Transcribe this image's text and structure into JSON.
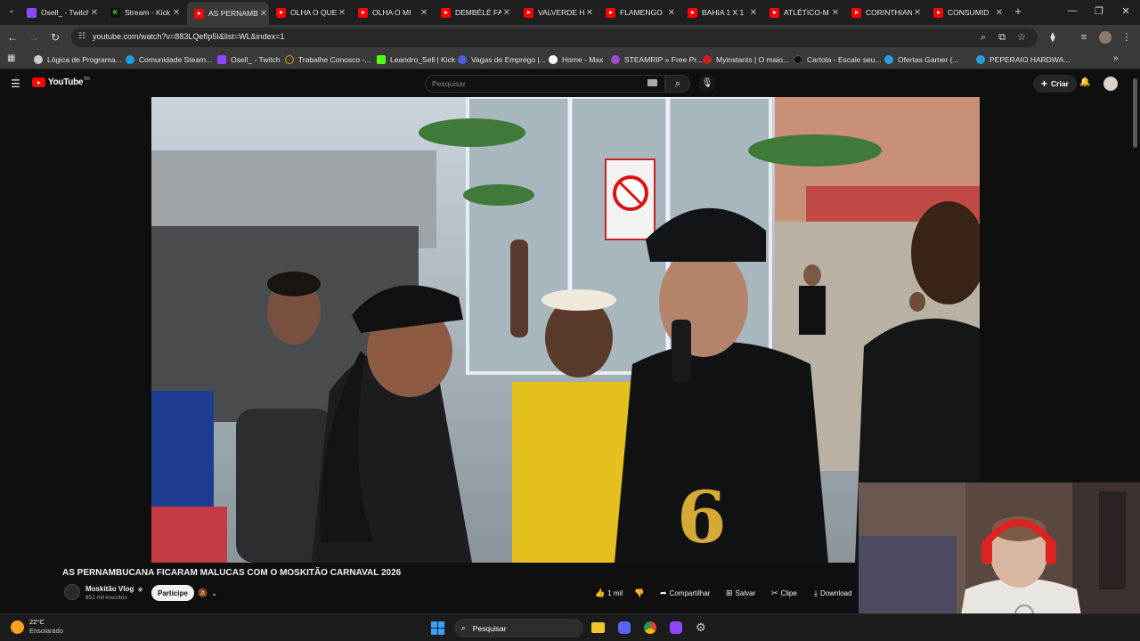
{
  "tabs": [
    {
      "title": "Osell_ - Twitch",
      "favicon": "twitch-icon"
    },
    {
      "title": "Stream - Kick",
      "favicon": "kick-icon"
    },
    {
      "title": "AS PERNAMBUCANA",
      "favicon": "youtube-icon",
      "active": true
    },
    {
      "title": "OLHA O QUE",
      "favicon": "youtube-icon"
    },
    {
      "title": "OLHA O MI",
      "favicon": "youtube-icon"
    },
    {
      "title": "DEMBÉLÉ FA",
      "favicon": "youtube-icon"
    },
    {
      "title": "VALVERDE H",
      "favicon": "youtube-icon"
    },
    {
      "title": "FLAMENGO",
      "favicon": "youtube-icon"
    },
    {
      "title": "BAHIA 1 X 1",
      "favicon": "youtube-icon"
    },
    {
      "title": "ATLÉTICO-M",
      "favicon": "youtube-icon"
    },
    {
      "title": "CORINTHIAN",
      "favicon": "youtube-icon"
    },
    {
      "title": "CONSUMID",
      "favicon": "youtube-icon"
    }
  ],
  "address": {
    "url": "youtube.com/watch?v=883LQefIp5I&list=WL&index=1"
  },
  "bookmarks": [
    {
      "label": "Lógica de Programa...",
      "color": "#cccccc"
    },
    {
      "label": "Comunidade Steam...",
      "color": "#1b9be0"
    },
    {
      "label": "Osell_ - Twitch",
      "color": "#9146ff"
    },
    {
      "label": "Trabalhe Conosco -...",
      "color": "#c8a000"
    },
    {
      "label": "Leandro_Sell | Kick",
      "color": "#53fc18"
    },
    {
      "label": "Vagas de Emprego |...",
      "color": "#4a5fe0"
    },
    {
      "label": "Home - Max",
      "color": "#ffffff"
    },
    {
      "label": "STEAMRIP » Free Pr...",
      "color": "#a04ad0"
    },
    {
      "label": "Myinstants | O maio...",
      "color": "#d02020"
    },
    {
      "label": "Cartola - Escale seu...",
      "color": "#333333"
    },
    {
      "label": "Ofertas Gamer (...",
      "color": "#2aa0e0"
    },
    {
      "label": "PEPERAIO HARDWA...",
      "color": "#2aa0e0"
    }
  ],
  "youtube": {
    "logo_text": "YouTube",
    "region": "BR",
    "search_placeholder": "Pesquisar",
    "create_label": "Criar"
  },
  "video": {
    "title": "AS PERNAMBUCANA FICARAM MALUCAS COM O MOSKITÃO CARNAVAL 2026",
    "channel": "Moskitão Vlog",
    "subscribers": "651 mil inscritos",
    "join_label": "Participe",
    "likes": "1 mil",
    "share_label": "Compartilhar",
    "save_label": "Salvar",
    "clip_label": "Clipe",
    "download_label": "Download"
  },
  "taskbar": {
    "temperature": "22°C",
    "weather": "Ensolarado",
    "search_label": "Pesquisar"
  }
}
